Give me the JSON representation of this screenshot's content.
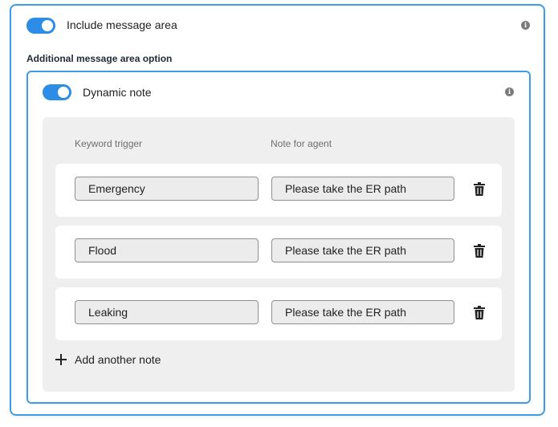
{
  "include_message_area": {
    "label": "Include message area",
    "enabled": true,
    "info_icon": "info-icon"
  },
  "additional_option": {
    "section_label": "Additional message area option"
  },
  "dynamic_note": {
    "label": "Dynamic note",
    "enabled": true,
    "info_icon": "info-icon",
    "headers": {
      "keyword": "Keyword trigger",
      "note": "Note for agent"
    },
    "rows": [
      {
        "keyword": "Emergency",
        "note": "Please take the ER path"
      },
      {
        "keyword": "Flood",
        "note": "Please take the ER path"
      },
      {
        "keyword": "Leaking",
        "note": "Please take the ER path"
      }
    ],
    "delete_icon": "trash-icon",
    "add_label": "Add another note",
    "add_icon": "plus-icon"
  },
  "colors": {
    "accent": "#2d8de6",
    "border": "#3d9be9",
    "panel": "#efefef"
  }
}
